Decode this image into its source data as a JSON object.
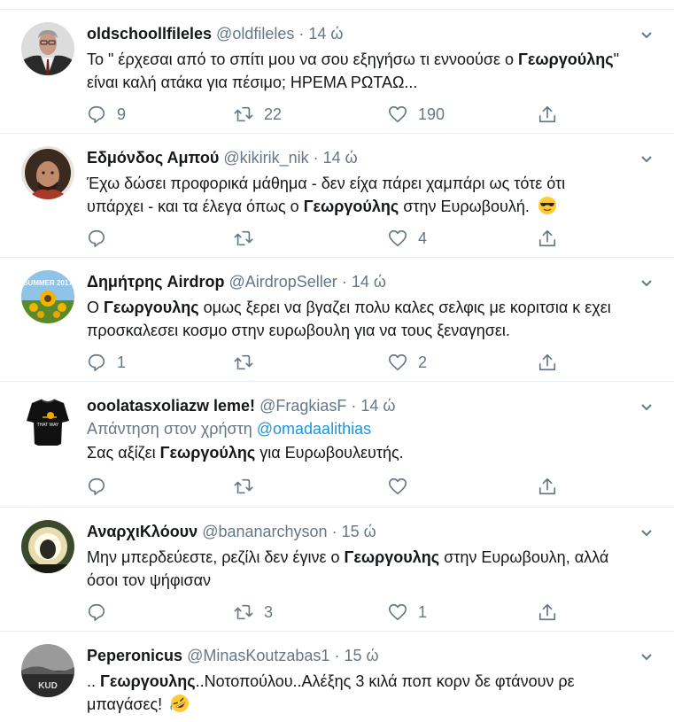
{
  "tweets": [
    {
      "name": "oldschoollfileles",
      "handle": "@oldfileles",
      "dot": "·",
      "time": "14 ώ",
      "text_parts": [
        "Το \" έρχεσαι από το σπίτι μου να σου εξηγήσω τι εννοούσε ο ",
        "Γεωργούλης",
        "\""
      ],
      "text_line2": "είναι καλή ατάκα για πέσιμο; ΗΡΕΜΑ ΡΩΤΑΩ...",
      "replies": "9",
      "retweets": "22",
      "likes": "190"
    },
    {
      "name": "Εδμόνδος Αμπού",
      "handle": "@kikirik_nik",
      "dot": "·",
      "time": "14 ώ",
      "text_line1": "Έχω δώσει προφορικά μάθημα - δεν είχα πάρει χαμπάρι ως τότε ότι",
      "text_parts": [
        "υπάρχει - και τα έλεγα όπως ο ",
        "Γεωργούλης",
        " στην Ευρωβουλή."
      ],
      "emoji": "smiling-face-with-sunglasses",
      "replies": "",
      "retweets": "",
      "likes": "4"
    },
    {
      "name": "Δημήτρης Airdrop",
      "handle": "@AirdropSeller",
      "dot": "·",
      "time": "14 ώ",
      "text_parts": [
        "Ο ",
        "Γεωργουλης",
        " ομως ξερει να βγαζει πολυ καλες σελφις με κοριτσια κ εχει"
      ],
      "text_line2": "προσκαλεσει κοσμο στην ευρωβουλη για να τους ξεναγησει.",
      "avatar_text": "SUMMER 2017",
      "replies": "1",
      "retweets": "",
      "likes": "2"
    },
    {
      "name": "ooolatasxoliazw leme!",
      "handle": "@FragkiasF",
      "dot": "·",
      "time": "14 ώ",
      "reply_prefix": "Απάντηση στον χρήστη",
      "reply_handle": "@omadaalithias",
      "text_parts": [
        "Σας αξίζει ",
        "Γεωργούλης",
        " για Ευρωβουλευτής."
      ],
      "avatar_text": "THAT WAY",
      "replies": "",
      "retweets": "",
      "likes": ""
    },
    {
      "name": "ΑναρχιΚλόουν",
      "handle": "@bananarchyson",
      "dot": "·",
      "time": "15 ώ",
      "text_parts": [
        "Μην μπερδεύεστε, ρεζίλι δεν έγινε ο ",
        "Γεωργουλης",
        " στην Ευρωβουλη, αλλά"
      ],
      "text_line2": "όσοι τον ψήφισαν",
      "replies": "",
      "retweets": "3",
      "likes": "1"
    },
    {
      "name": "Peperonicus",
      "handle": "@MinasKoutzabas1",
      "dot": "·",
      "time": "15 ώ",
      "text_parts": [
        ".. ",
        "Γεωργουλης",
        "..Νοτοπούλου..Αλέξης 3 κιλά ποπ κορν δε φτάνουν ρε"
      ],
      "text_line2": "μπαγάσες!",
      "emoji": "rolling-on-the-floor-laughing",
      "avatar_text": "KUD"
    }
  ],
  "icons": {
    "reply": "reply-icon",
    "retweet": "retweet-icon",
    "like": "heart-icon",
    "share": "share-icon",
    "caret": "chevron-down-icon"
  },
  "colors": {
    "secondary_text": "#657786",
    "link": "#1b95e0",
    "divider": "#e6ecf0"
  }
}
